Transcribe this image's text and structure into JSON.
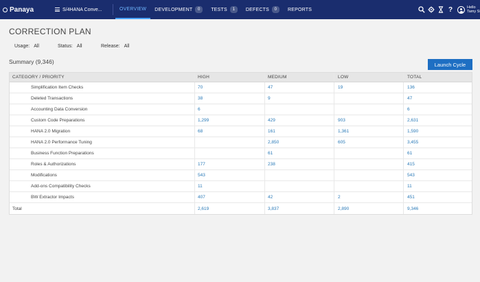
{
  "topbar": {
    "logo": "Panaya",
    "project": "S/4HANA Conve...",
    "nav": [
      {
        "label": "OVERVIEW",
        "badge": null,
        "active": true
      },
      {
        "label": "DEVELOPMENT",
        "badge": "0",
        "active": false
      },
      {
        "label": "TESTS",
        "badge": "1",
        "active": false
      },
      {
        "label": "DEFECTS",
        "badge": "0",
        "active": false
      },
      {
        "label": "REPORTS",
        "badge": null,
        "active": false
      }
    ],
    "icons": [
      "search-icon",
      "gear-icon",
      "hourglass-icon",
      "help-icon",
      "user-avatar-icon"
    ],
    "help_glyph": "?",
    "user_greeting": "Hello",
    "user_name": "Tamy St..."
  },
  "page": {
    "title": "CORRECTION PLAN",
    "filters": {
      "usage_label": "Usage:",
      "usage_value": "All",
      "status_label": "Status:",
      "status_value": "All",
      "release_label": "Release:",
      "release_value": "All"
    },
    "summary": "Summary (9,346)",
    "launch_button": "Launch Cycle"
  },
  "table": {
    "headers": [
      "CATEGORY / PRIORITY",
      "HIGH",
      "MEDIUM",
      "LOW",
      "TOTAL"
    ],
    "rows": [
      {
        "category": "Simplification Item Checks",
        "high": "70",
        "medium": "47",
        "low": "19",
        "total": "136"
      },
      {
        "category": "Deleted Transactions",
        "high": "38",
        "medium": "9",
        "low": "",
        "total": "47"
      },
      {
        "category": "Accounting Data Conversion",
        "high": "6",
        "medium": "",
        "low": "",
        "total": "6"
      },
      {
        "category": "Custom Code Preparations",
        "high": "1,299",
        "medium": "429",
        "low": "903",
        "total": "2,631"
      },
      {
        "category": "HANA 2.0 Migration",
        "high": "68",
        "medium": "161",
        "low": "1,361",
        "total": "1,590"
      },
      {
        "category": "HANA 2.0 Performance Tuning",
        "high": "",
        "medium": "2,850",
        "low": "605",
        "total": "3,455"
      },
      {
        "category": "Business Function Preparations",
        "high": "",
        "medium": "61",
        "low": "",
        "total": "61"
      },
      {
        "category": "Roles & Authorizations",
        "high": "177",
        "medium": "238",
        "low": "",
        "total": "415"
      },
      {
        "category": "Modifications",
        "high": "543",
        "medium": "",
        "low": "",
        "total": "543"
      },
      {
        "category": "Add-ons Compatibility Checks",
        "high": "11",
        "medium": "",
        "low": "",
        "total": "11"
      },
      {
        "category": "BW Extractor Impacts",
        "high": "407",
        "medium": "42",
        "low": "2",
        "total": "451"
      }
    ],
    "total_row": {
      "category": "Total",
      "high": "2,619",
      "medium": "3,837",
      "low": "2,890",
      "total": "9,346"
    }
  },
  "colors": {
    "topbar": "#1a2d6e",
    "active_nav": "#6fb6ff",
    "link_number": "#2a7ab8",
    "button": "#1e6fc3"
  }
}
